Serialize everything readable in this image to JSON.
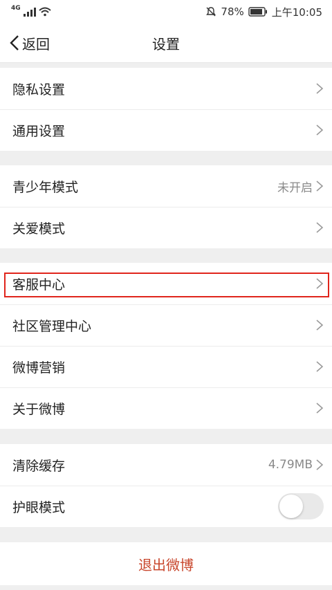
{
  "status_bar": {
    "network": "4G",
    "battery": "78%",
    "time": "上午10:05"
  },
  "nav": {
    "back_label": "返回",
    "title": "设置"
  },
  "groups": [
    {
      "items": [
        {
          "label": "隐私设置"
        },
        {
          "label": "通用设置"
        }
      ]
    },
    {
      "items": [
        {
          "label": "青少年模式",
          "value": "未开启"
        },
        {
          "label": "关爱模式"
        }
      ]
    },
    {
      "items": [
        {
          "label": "客服中心"
        },
        {
          "label": "社区管理中心"
        },
        {
          "label": "微博营销"
        },
        {
          "label": "关于微博"
        }
      ]
    },
    {
      "items": [
        {
          "label": "清除缓存",
          "value": "4.79MB"
        },
        {
          "label": "护眼模式",
          "toggle": false
        }
      ]
    }
  ],
  "logout_label": "退出微博",
  "colors": {
    "highlight": "#e0241b",
    "logout": "#c8462c"
  }
}
